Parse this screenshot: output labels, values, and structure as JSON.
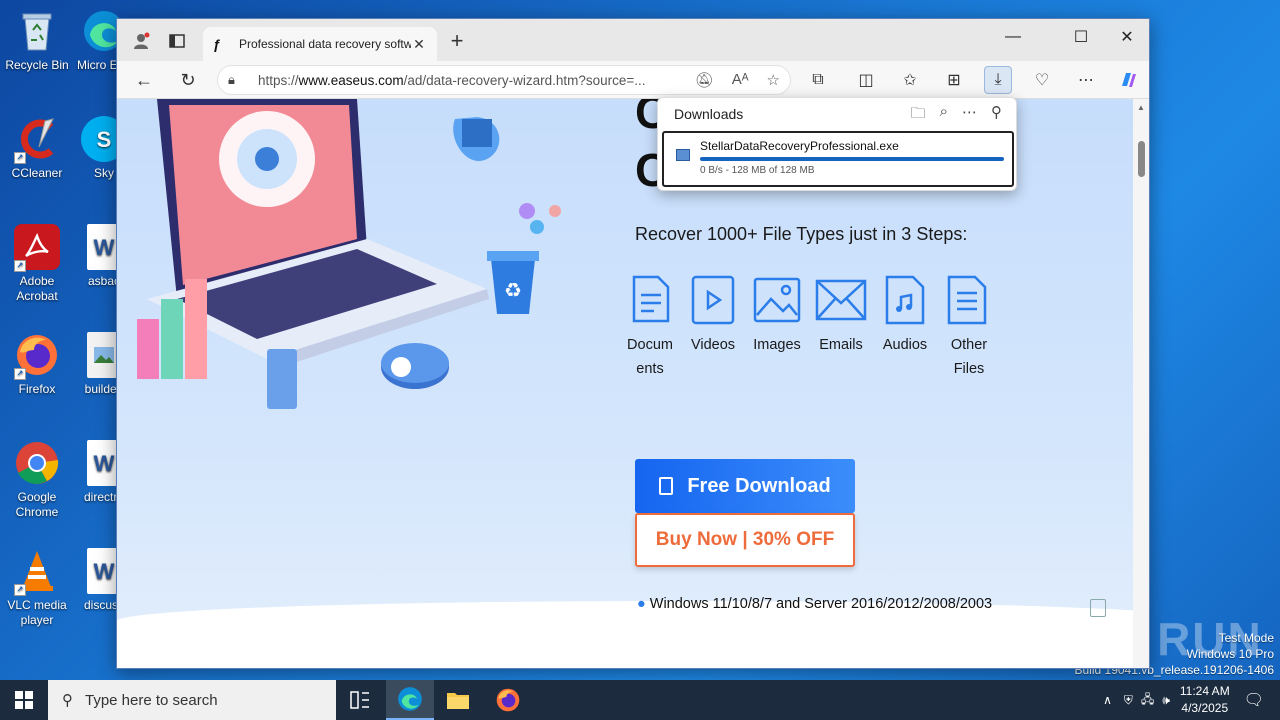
{
  "desktop": {
    "icons": [
      {
        "label": "Recycle Bin"
      },
      {
        "label": "CCleaner"
      },
      {
        "label": "Adobe Acrobat"
      },
      {
        "label": "Firefox"
      },
      {
        "label": "Google Chrome"
      },
      {
        "label": "VLC media player"
      },
      {
        "label": "Micro Edg"
      },
      {
        "label": "Sky"
      },
      {
        "label": "asbac"
      },
      {
        "label": "builded"
      },
      {
        "label": "directre"
      },
      {
        "label": "discuss"
      }
    ],
    "watermark": {
      "line1": "Test Mode",
      "line2": "Windows 10 Pro",
      "line3": "Build 19041.vb_release.191206-1406"
    },
    "anyrun": "ANY RUN"
  },
  "browser": {
    "tab_title": "Professional data recovery software",
    "url_prefix": "https://",
    "url_domain": "www.easeus.com",
    "url_rest": "/ad/data-recovery-wizard.htm?source=...",
    "downloads": {
      "heading": "Downloads",
      "file_name": "StellarDataRecoveryProfessional.exe",
      "status": "0 B/s - 128 MB of 128 MB",
      "progress": 1.0
    }
  },
  "page": {
    "heading_fragment_1": "C",
    "heading_fragment_2": "C",
    "steps_title": "Recover 1000+ File Types just in 3 Steps:",
    "file_types": [
      {
        "label": "Docum ents",
        "icon": "document-icon"
      },
      {
        "label": "Videos",
        "icon": "video-icon"
      },
      {
        "label": "Images",
        "icon": "image-icon"
      },
      {
        "label": "Emails",
        "icon": "email-icon"
      },
      {
        "label": "Audios",
        "icon": "audio-icon"
      },
      {
        "label": "Other Files",
        "icon": "other-files-icon"
      }
    ],
    "free_download": "Free Download",
    "buy_now": "Buy Now | 30% OFF",
    "os_support": "Windows 11/10/8/7 and Server 2016/2012/2008/2003"
  },
  "taskbar": {
    "search_placeholder": "Type here to search",
    "time": "11:24 AM",
    "date": "4/3/2025"
  },
  "colors": {
    "accent": "#1565f0",
    "buy": "#ee6b3c",
    "file_icon": "#2b7de9"
  }
}
